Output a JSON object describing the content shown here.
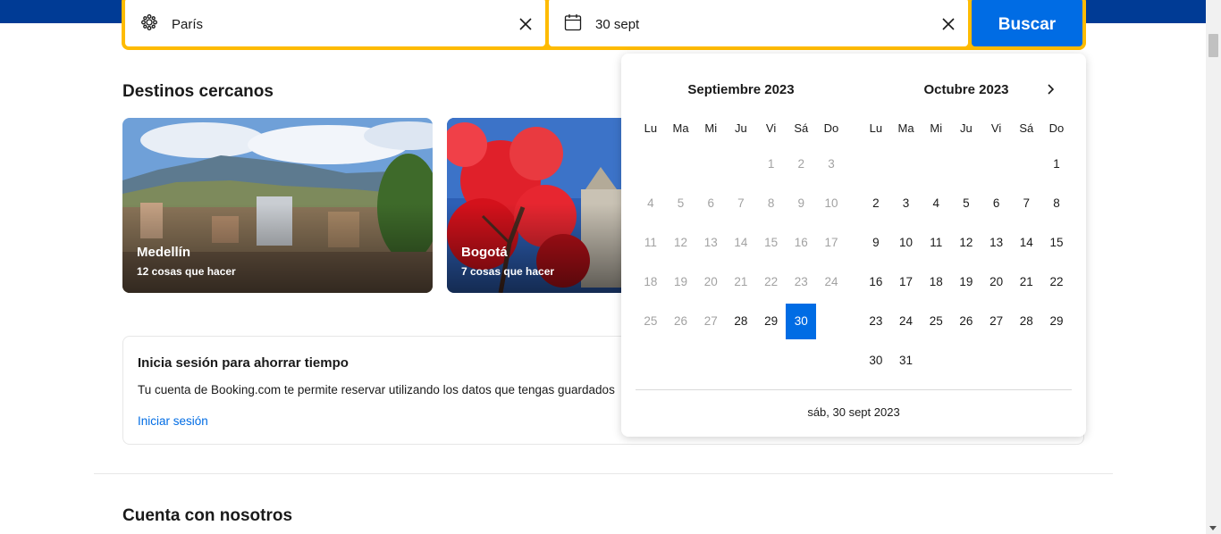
{
  "search": {
    "destination_value": "París",
    "date_value": "30 sept",
    "button_label": "Buscar"
  },
  "nearby": {
    "title": "Destinos cercanos",
    "cards": [
      {
        "name": "Medellín",
        "subtitle": "12 cosas que hacer"
      },
      {
        "name": "Bogotá",
        "subtitle": "7 cosas que hacer"
      }
    ]
  },
  "signin": {
    "title": "Inicia sesión para ahorrar tiempo",
    "description": "Tu cuenta de Booking.com te permite reservar utilizando los datos que tengas guardados",
    "link": "Iniciar sesión"
  },
  "section_bottom": {
    "title": "Cuenta con nosotros"
  },
  "calendar": {
    "weekdays": [
      "Lu",
      "Ma",
      "Mi",
      "Ju",
      "Vi",
      "Sá",
      "Do"
    ],
    "months": [
      {
        "title": "Septiembre 2023",
        "offset": 4,
        "days": [
          "1",
          "2",
          "3",
          "4",
          "5",
          "6",
          "7",
          "8",
          "9",
          "10",
          "11",
          "12",
          "13",
          "14",
          "15",
          "16",
          "17",
          "18",
          "19",
          "20",
          "21",
          "22",
          "23",
          "24",
          "25",
          "26",
          "27",
          "28",
          "29",
          "30"
        ],
        "past_until": 27,
        "selected": 30
      },
      {
        "title": "Octubre 2023",
        "offset": 6,
        "days": [
          "1",
          "2",
          "3",
          "4",
          "5",
          "6",
          "7",
          "8",
          "9",
          "10",
          "11",
          "12",
          "13",
          "14",
          "15",
          "16",
          "17",
          "18",
          "19",
          "20",
          "21",
          "22",
          "23",
          "24",
          "25",
          "26",
          "27",
          "28",
          "29",
          "30",
          "31"
        ],
        "past_until": 0,
        "selected": 0
      }
    ],
    "footer": "sáb, 30 sept 2023"
  },
  "colors": {
    "brand_blue": "#003b95",
    "accent_blue": "#006ce4",
    "search_frame": "#febb02"
  }
}
